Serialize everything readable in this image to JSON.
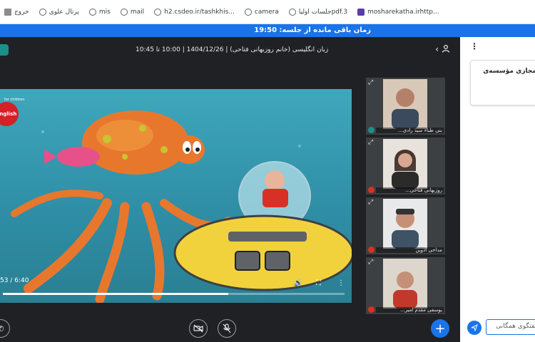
{
  "bookmarks": [
    {
      "label": "خروج",
      "icon": "folder-icon"
    },
    {
      "label": "پرتال علوی",
      "icon": "globe-icon"
    },
    {
      "label": "mis",
      "icon": "globe-icon"
    },
    {
      "label": "mail",
      "icon": "globe-icon"
    },
    {
      "label": "h2.csdeo.ir/tashkhis...",
      "icon": "globe-icon"
    },
    {
      "label": "camera",
      "icon": "globe-icon"
    },
    {
      "label": "جلسات اولیاpdf.3",
      "icon": "globe-icon"
    },
    {
      "label": "mosharekatha.irhttp...",
      "icon": "site-logo-icon"
    }
  ],
  "timer": "زمان باقی مانده از جلسه: 19:50",
  "meeting": {
    "title": "زبان انگلیسی (خانم روزبهانی فتاحی) | 1404/12/26 | 10:00 تا 10:45"
  },
  "video": {
    "time": "53 / 6:40",
    "progress": 0.66,
    "logo_text": "English",
    "logo_sub": "for children"
  },
  "participants": [
    {
      "name": "بنی طباء سید رادی...",
      "mic": "on"
    },
    {
      "name": "روزبهانی فتاحی...",
      "mic": "off"
    },
    {
      "name": "مداحی آذوین",
      "mic": "off"
    },
    {
      "name": "یوسفی مقدم امیر...",
      "mic": "off"
    }
  ],
  "panel": {
    "card_text": "مجازی مؤسسه‌ی",
    "chat_placeholder": "گفتگوی همگانی"
  },
  "colors": {
    "accent": "#1a73e8",
    "background": "#202124",
    "mic_off": "#d93025"
  }
}
